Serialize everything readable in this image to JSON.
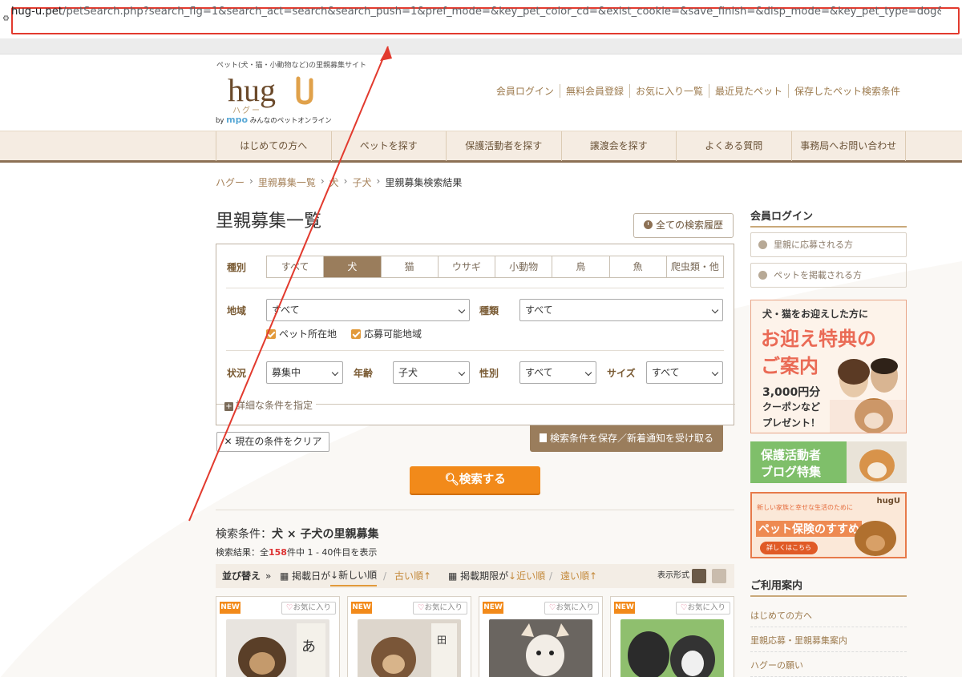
{
  "browser": {
    "url_host": "hug-u.pet",
    "url_rest": "/petSearch.php?search_flg=1&search_act=search&search_push=1&pref_mode=&key_pet_color_cd=&exist_cookie=&save_finish=&disp_mode=&key_pet_type=dog&key_visit_flg=on&key_recruit..."
  },
  "header": {
    "tagline": "ペット(犬・猫・小動物など)の里親募集サイト",
    "logo_text": "hugU",
    "logo_sub": "ハグー",
    "byline_prefix": "by",
    "byline_brand": "mpo",
    "byline_rest": "みんなのペットオンライン",
    "links": [
      "会員ログイン",
      "無料会員登録",
      "お気に入り一覧",
      "最近見たペット",
      "保存したペット検索条件"
    ]
  },
  "nav": [
    "はじめての方へ",
    "ペットを探す",
    "保護活動者を探す",
    "譲渡会を探す",
    "よくある質問",
    "事務局へお問い合わせ"
  ],
  "breadcrumb": [
    "ハグー",
    "里親募集一覧",
    "犬",
    "子犬",
    "里親募集検索結果"
  ],
  "page_title": "里親募集一覧",
  "history_button": "全ての検索履歴",
  "search": {
    "species_label": "種別",
    "species": [
      "すべて",
      "犬",
      "猫",
      "ウサギ",
      "小動物",
      "鳥",
      "魚",
      "爬虫類・他"
    ],
    "species_active_index": 1,
    "region_label": "地域",
    "region_value": "すべて",
    "breed_label": "種類",
    "breed_value": "すべて",
    "check_pet_location": "ペット所在地",
    "check_apply_area": "応募可能地域",
    "status_label": "状況",
    "status_value": "募集中",
    "age_label": "年齢",
    "age_value": "子犬",
    "sex_label": "性別",
    "sex_value": "すべて",
    "size_label": "サイズ",
    "size_value": "すべて",
    "detail_toggle": "詳細な条件を指定"
  },
  "clear_button": "現在の条件をクリア",
  "save_button": "検索条件を保存／新着通知を受け取る",
  "search_button": "検索する",
  "results": {
    "cond_prefix": "検索条件：",
    "cond_value": "犬 × 子犬の里親募集",
    "count_prefix": "検索結果：全",
    "count_total": "158",
    "count_suffix": "件中 1 - 40件目を表示"
  },
  "sort": {
    "label": "並び替え",
    "posted_label": "掲載日が",
    "newest": "新しい順",
    "oldest": "古い順",
    "deadline_label": "掲載期限が",
    "nearest": "近い順",
    "farthest": "遠い順",
    "display_label": "表示形式"
  },
  "cards": [
    {
      "badge": "NEW",
      "fav": "お気に入り"
    },
    {
      "badge": "NEW",
      "fav": "お気に入り"
    },
    {
      "badge": "NEW",
      "fav": "お気に入り"
    },
    {
      "badge": "NEW",
      "fav": "お気に入り"
    }
  ],
  "sidebar": {
    "login_title": "会員ログイン",
    "login_applicant": "里親に応募される方",
    "login_poster": "ペットを掲載される方",
    "banner1_top": "犬・猫をお迎えした方に",
    "banner1_main1": "お迎え特典の",
    "banner1_main2": "ご案内",
    "banner1_amount": "3,000円分",
    "banner1_coupon": "クーポンなど",
    "banner1_present": "プレゼント！",
    "banner2_line1": "保護活動者",
    "banner2_line2": "ブログ特集",
    "banner3_top": "新しい家族と幸せな生活のために",
    "banner3_main": "ペット保険のすすめ",
    "banner3_btn": "詳しくはこちら",
    "banner3_logo": "hugU",
    "guide_title": "ご利用案内",
    "guide_links": [
      "はじめての方へ",
      "里親応募・里親募集案内",
      "ハグーの願い"
    ]
  },
  "colors": {
    "accent_brown": "#9a7d5c",
    "accent_orange": "#f28a1a",
    "link_gold": "#9c7a4d",
    "annotation_red": "#e23a2e"
  }
}
